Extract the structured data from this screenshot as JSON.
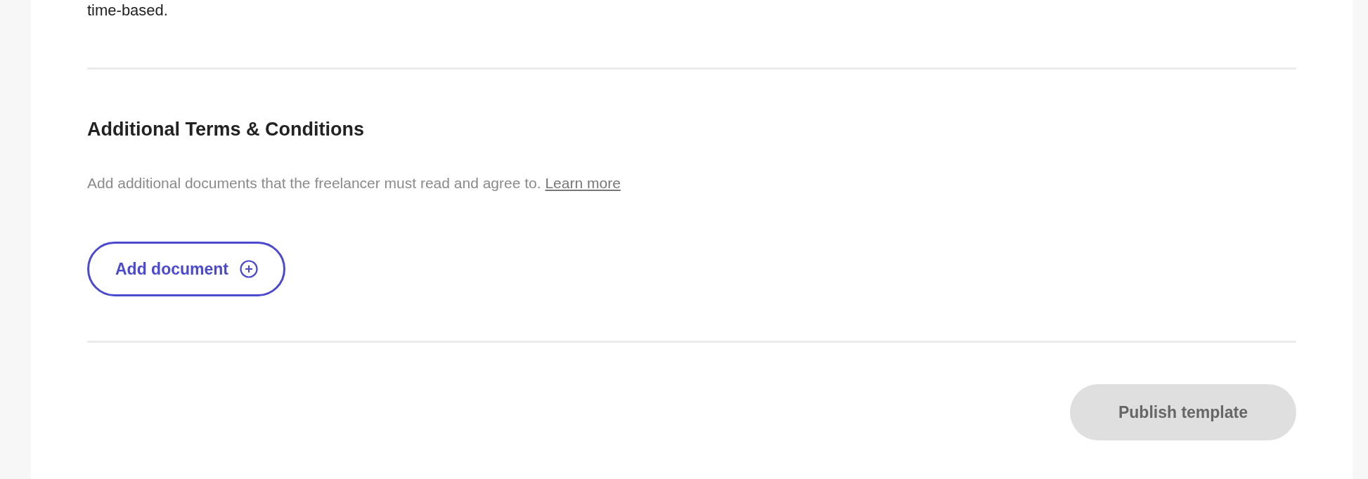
{
  "intro_tail": "time-based.",
  "terms_section": {
    "title": "Additional Terms & Conditions",
    "description": "Add additional documents that the freelancer must read and agree to.",
    "link": "Learn more",
    "add_button": {
      "label": "Add document"
    }
  },
  "publish_button": {
    "label": "Publish template",
    "disabled": true
  }
}
